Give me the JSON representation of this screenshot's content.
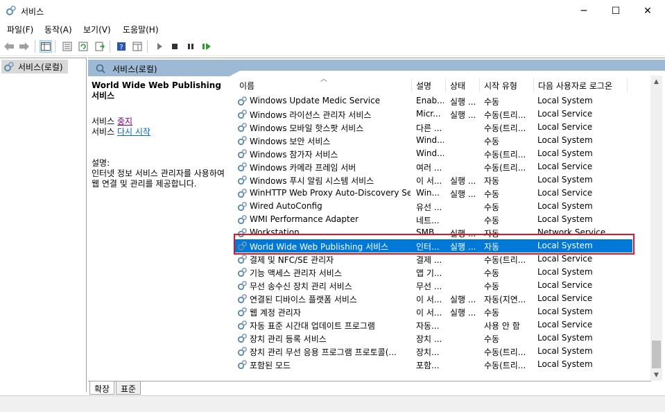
{
  "window": {
    "title": "서비스",
    "minimize": "─",
    "maximize": "☐",
    "close": "✕"
  },
  "menu": [
    "파일(F)",
    "동작(A)",
    "보기(V)",
    "도움말(H)"
  ],
  "tree": {
    "root_label": "서비스(로컬)"
  },
  "pane": {
    "header_label": "서비스(로컬)"
  },
  "details": {
    "service_title": "World Wide Web Publishing 서비스",
    "stop_prefix": "서비스 ",
    "stop_link": "중지",
    "restart_prefix": "서비스 ",
    "restart_link": "다시 시작",
    "desc_label": "설명:",
    "desc_text": "인터넷 정보 서비스 관리자를 사용하여 웹 연결 및 관리를 제공합니다."
  },
  "columns": {
    "name": "이름",
    "desc": "설명",
    "status": "상태",
    "startup": "시작 유형",
    "logon": "다음 사용자로 로그온"
  },
  "services": [
    {
      "name": "Windows Update Medic Service",
      "desc": "Enab...",
      "status": "실행 ...",
      "startup": "수동",
      "logon": "Local System"
    },
    {
      "name": "Windows 라이선스 관리자 서비스",
      "desc": "Micr...",
      "status": "실행 ...",
      "startup": "수동(트리...",
      "logon": "Local Service"
    },
    {
      "name": "Windows 모바일 핫스팟 서비스",
      "desc": "다른 ...",
      "status": "",
      "startup": "수동(트리...",
      "logon": "Local Service"
    },
    {
      "name": "Windows 보안 서비스",
      "desc": "Wind...",
      "status": "",
      "startup": "수동",
      "logon": "Local System"
    },
    {
      "name": "Windows 참가자 서비스",
      "desc": "Wind...",
      "status": "",
      "startup": "수동(트리...",
      "logon": "Local System"
    },
    {
      "name": "Windows 카메라 프레임 서버",
      "desc": "여러 ...",
      "status": "",
      "startup": "수동(트리...",
      "logon": "Local Service"
    },
    {
      "name": "Windows 푸시 알림 시스템 서비스",
      "desc": "이 서...",
      "status": "실행 ...",
      "startup": "자동",
      "logon": "Local System"
    },
    {
      "name": "WinHTTP Web Proxy Auto-Discovery Ser...",
      "desc": "Win...",
      "status": "실행 ...",
      "startup": "수동",
      "logon": "Local Service"
    },
    {
      "name": "Wired AutoConfig",
      "desc": "유선 ...",
      "status": "",
      "startup": "수동",
      "logon": "Local System"
    },
    {
      "name": "WMI Performance Adapter",
      "desc": "네트...",
      "status": "",
      "startup": "수동",
      "logon": "Local System"
    },
    {
      "name": "Workstation",
      "desc": "SMB...",
      "status": "실행 ...",
      "startup": "자동",
      "logon": "Network Service"
    },
    {
      "name": "World Wide Web Publishing 서비스",
      "desc": "인터...",
      "status": "실행 ...",
      "startup": "자동",
      "logon": "Local System"
    },
    {
      "name": "결제 및 NFC/SE 관리자",
      "desc": "결제 ...",
      "status": "",
      "startup": "수동(트리...",
      "logon": "Local Service"
    },
    {
      "name": "기능 액세스 관리자 서비스",
      "desc": "앱 기...",
      "status": "",
      "startup": "수동",
      "logon": "Local System"
    },
    {
      "name": "무선 송수신 장치 관리 서비스",
      "desc": "무선 ...",
      "status": "",
      "startup": "수동",
      "logon": "Local Service"
    },
    {
      "name": "연결된 디바이스 플랫폼 서비스",
      "desc": "이 서...",
      "status": "실행 ...",
      "startup": "자동(지연...",
      "logon": "Local Service"
    },
    {
      "name": "웹 계정 관리자",
      "desc": "이 서...",
      "status": "실행 ...",
      "startup": "수동",
      "logon": "Local System"
    },
    {
      "name": "자동 표준 시간대 업데이트 프로그램",
      "desc": "자동...",
      "status": "",
      "startup": "사용 안 함",
      "logon": "Local Service"
    },
    {
      "name": "장치 관리 등록 서비스",
      "desc": "장치 ...",
      "status": "",
      "startup": "수동",
      "logon": "Local System"
    },
    {
      "name": "장치 관리 무선 응용 프로그램 프로토콜(...",
      "desc": "장치...",
      "status": "",
      "startup": "수동(트리...",
      "logon": "Local System"
    },
    {
      "name": "포함된 모드",
      "desc": "포함...",
      "status": "",
      "startup": "수동(트리...",
      "logon": "Local System"
    }
  ],
  "selected_index": 11,
  "tabs": {
    "extended": "확장",
    "standard": "표준"
  },
  "colors": {
    "selection": "#0078d7",
    "pane_header": "#9db9d3",
    "highlight": "#e81123"
  }
}
